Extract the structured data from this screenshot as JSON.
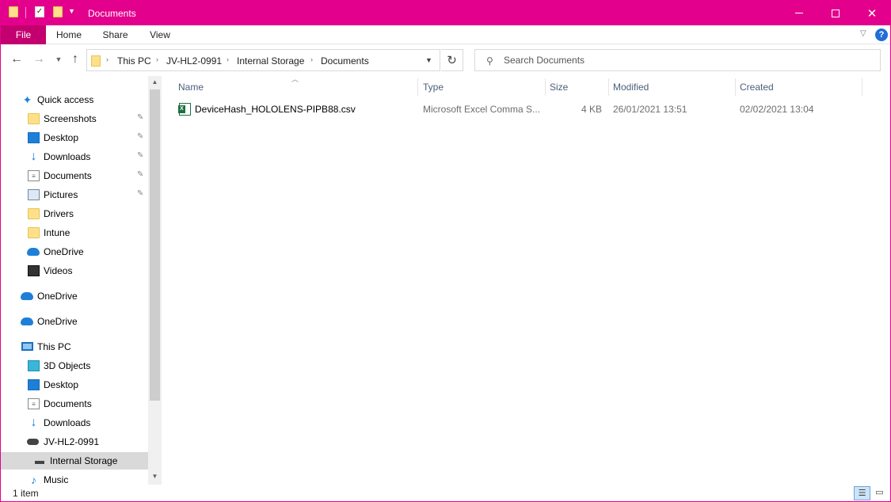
{
  "titlebar": {
    "title": "Documents",
    "accent_color": "#e3008c",
    "minimize_icon": "minimize-icon",
    "maximize_icon": "maximize-icon",
    "close_icon": "close-icon",
    "close_glyph": "✕"
  },
  "ribbon": {
    "tabs": [
      {
        "label": "File"
      },
      {
        "label": "Home"
      },
      {
        "label": "Share"
      },
      {
        "label": "View"
      }
    ],
    "help_glyph": "?"
  },
  "address": {
    "crumbs": [
      "This PC",
      "JV-HL2-0991",
      "Internal Storage",
      "Documents"
    ],
    "refresh_glyph": "↻"
  },
  "search": {
    "placeholder": "Search Documents"
  },
  "navpane": {
    "items": [
      {
        "label": "Quick access",
        "icon": "star-icon",
        "pinned": false
      },
      {
        "label": "Screenshots",
        "icon": "folder-icon",
        "pinned": true
      },
      {
        "label": "Desktop",
        "icon": "desktop-icon",
        "pinned": true
      },
      {
        "label": "Downloads",
        "icon": "download-icon",
        "pinned": true
      },
      {
        "label": "Documents",
        "icon": "document-icon",
        "pinned": true
      },
      {
        "label": "Pictures",
        "icon": "pictures-icon",
        "pinned": true
      },
      {
        "label": "Drivers",
        "icon": "folder-icon",
        "pinned": false
      },
      {
        "label": "Intune",
        "icon": "folder-icon",
        "pinned": false
      },
      {
        "label": "OneDrive",
        "icon": "onedrive-icon",
        "pinned": false
      },
      {
        "label": "Videos",
        "icon": "videos-icon",
        "pinned": false
      },
      {
        "label": "OneDrive",
        "icon": "onedrive-icon",
        "pinned": false
      },
      {
        "label": "OneDrive",
        "icon": "onedrive-icon",
        "pinned": false
      },
      {
        "label": "This PC",
        "icon": "computer-icon",
        "pinned": false
      },
      {
        "label": "3D Objects",
        "icon": "3d-objects-icon",
        "pinned": false
      },
      {
        "label": "Desktop",
        "icon": "desktop-icon",
        "pinned": false
      },
      {
        "label": "Documents",
        "icon": "document-icon",
        "pinned": false
      },
      {
        "label": "Downloads",
        "icon": "download-icon",
        "pinned": false
      },
      {
        "label": "JV-HL2-0991",
        "icon": "hololens-icon",
        "pinned": false
      },
      {
        "label": "Internal Storage",
        "icon": "drive-icon",
        "pinned": false,
        "selected": true
      },
      {
        "label": "Music",
        "icon": "music-icon",
        "pinned": false
      }
    ]
  },
  "columns": [
    {
      "label": "Name"
    },
    {
      "label": "Type"
    },
    {
      "label": "Size"
    },
    {
      "label": "Modified"
    },
    {
      "label": "Created"
    }
  ],
  "files": [
    {
      "name": "DeviceHash_HOLOLENS-PIPB88.csv",
      "type": "Microsoft Excel Comma S...",
      "size": "4 KB",
      "modified": "26/01/2021 13:51",
      "created": "02/02/2021 13:04",
      "icon": "excel-csv-icon"
    }
  ],
  "status": {
    "item_count": "1 item"
  }
}
